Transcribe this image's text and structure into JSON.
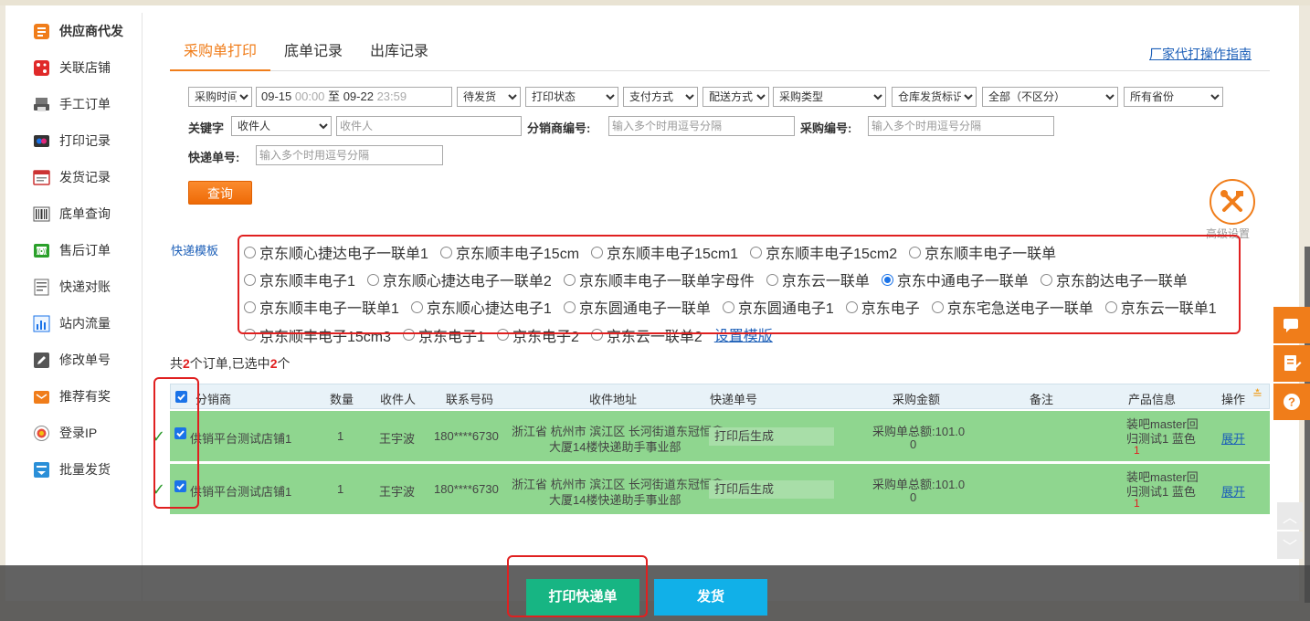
{
  "sidebar": {
    "items": [
      {
        "label": "供应商代发",
        "icon": "supplier-icon"
      },
      {
        "label": "关联店铺",
        "icon": "store-icon"
      },
      {
        "label": "手工订单",
        "icon": "manual-order-icon"
      },
      {
        "label": "打印记录",
        "icon": "print-record-icon"
      },
      {
        "label": "发货记录",
        "icon": "ship-record-icon"
      },
      {
        "label": "底单查询",
        "icon": "barcode-icon"
      },
      {
        "label": "售后订单",
        "icon": "after-sale-icon"
      },
      {
        "label": "快递对账",
        "icon": "reconcile-icon"
      },
      {
        "label": "站内流量",
        "icon": "traffic-icon"
      },
      {
        "label": "修改单号",
        "icon": "edit-icon"
      },
      {
        "label": "推荐有奖",
        "icon": "reward-icon"
      },
      {
        "label": "登录IP",
        "icon": "login-ip-icon"
      },
      {
        "label": "批量发货",
        "icon": "batch-ship-icon"
      }
    ]
  },
  "tabs": {
    "items": [
      "采购单打印",
      "底单记录",
      "出库记录"
    ],
    "guide_link": "厂家代打操作指南"
  },
  "filters": {
    "time_type": "采购时间",
    "date_start": "09-15",
    "time_start": "00:00",
    "date_sep": "至",
    "date_end": "09-22",
    "time_end": "23:59",
    "status": "待发货",
    "print_status": "打印状态",
    "payment": "支付方式",
    "delivery": "配送方式",
    "purchase_type": "采购类型",
    "warehouse": "仓库发货标识",
    "differentiate": "全部（不区分）",
    "province": "所有省份",
    "keyword_label": "关键字",
    "keyword_type": "收件人",
    "keyword_placeholder": "收件人",
    "distributor_label": "分销商编号:",
    "distributor_placeholder": "输入多个时用逗号分隔",
    "purchase_no_label": "采购编号:",
    "purchase_no_placeholder": "输入多个时用逗号分隔",
    "express_no_label": "快递单号:",
    "express_no_placeholder": "输入多个时用逗号分隔",
    "query_button": "查询",
    "advanced_label": "高级设置"
  },
  "templates": {
    "label": "快递模板",
    "rows": [
      [
        "京东顺心捷达电子一联单1",
        "京东顺丰电子15cm",
        "京东顺丰电子15cm1",
        "京东顺丰电子15cm2",
        "京东顺丰电子一联单"
      ],
      [
        "京东顺丰电子1",
        "京东顺心捷达电子一联单2",
        "京东顺丰电子一联单字母件",
        "京东云一联单",
        "京东中通电子一联单",
        "京东韵达电子一联单"
      ],
      [
        "京东顺丰电子一联单1",
        "京东顺心捷达电子1",
        "京东圆通电子一联单",
        "京东圆通电子1",
        "京东电子",
        "京东宅急送电子一联单",
        "京东云一联单1"
      ],
      [
        "京东顺丰电子15cm3",
        "京东电子1",
        "京东电子2",
        "京东云一联单2"
      ]
    ],
    "selected": "京东中通电子一联单",
    "set_link": "设置模版"
  },
  "summary": {
    "prefix": "共",
    "total": "2",
    "middle": "个订单,已选中",
    "selected": "2",
    "suffix": "个"
  },
  "table": {
    "headers": [
      "分销商",
      "数量",
      "收件人",
      "联系号码",
      "收件地址",
      "快递单号",
      "采购金额",
      "备注",
      "产品信息",
      "操作"
    ],
    "rows": [
      {
        "distributor": "供销平台测试店铺1",
        "qty": "1",
        "receiver": "王宇波",
        "phone": "180****6730",
        "address_line1": "浙江省 杭州市 滨江区 长河街道东冠恒鑫",
        "address_line2": "大厦14楼快递助手事业部",
        "express": "打印后生成",
        "amount_line1": "采购单总额:101.0",
        "amount_line2": "0",
        "product_line1": "装吧master回",
        "product_line2": "归测试1 蓝色",
        "product_qty": "1",
        "action": "展开"
      },
      {
        "distributor": "供销平台测试店铺1",
        "qty": "1",
        "receiver": "王宇波",
        "phone": "180****6730",
        "address_line1": "浙江省 杭州市 滨江区 长河街道东冠恒鑫",
        "address_line2": "大厦14楼快递助手事业部",
        "express": "打印后生成",
        "amount_line1": "采购单总额:101.0",
        "amount_line2": "0",
        "product_line1": "装吧master回",
        "product_line2": "归测试1 蓝色",
        "product_qty": "1",
        "action": "展开"
      }
    ]
  },
  "actions": {
    "print_button": "打印快递单",
    "ship_button": "发货"
  },
  "colors": {
    "accent": "#f07d1a",
    "row_selected": "#8fd68f",
    "print_button": "#17b583",
    "ship_button": "#11b0e8",
    "highlight": "#e02020"
  }
}
